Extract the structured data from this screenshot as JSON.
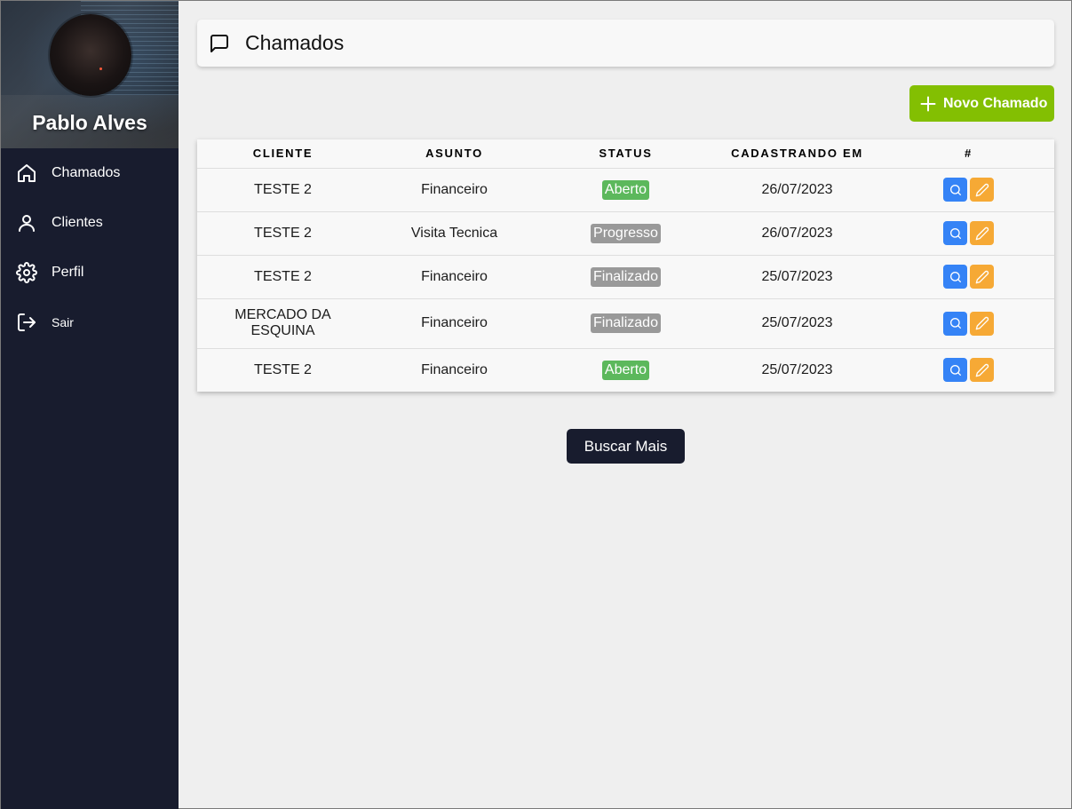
{
  "user": {
    "name": "Pablo Alves"
  },
  "nav": {
    "items": [
      {
        "label": "Chamados",
        "icon": "home-icon"
      },
      {
        "label": "Clientes",
        "icon": "user-icon"
      },
      {
        "label": "Perfil",
        "icon": "gear-icon"
      },
      {
        "label": "Sair",
        "icon": "logout-icon"
      }
    ]
  },
  "header": {
    "title": "Chamados",
    "icon": "message-square-icon"
  },
  "toolbar": {
    "new_label": "Novo Chamado",
    "new_icon": "plus-icon"
  },
  "table": {
    "columns": [
      "CLIENTE",
      "ASUNTO",
      "STATUS",
      "CADASTRANDO EM",
      "#"
    ],
    "rows": [
      {
        "cliente": "TESTE 2",
        "assunto": "Financeiro",
        "status": "Aberto",
        "data": "26/07/2023"
      },
      {
        "cliente": "TESTE 2",
        "assunto": "Visita Tecnica",
        "status": "Progresso",
        "data": "26/07/2023"
      },
      {
        "cliente": "TESTE 2",
        "assunto": "Financeiro",
        "status": "Finalizado",
        "data": "25/07/2023"
      },
      {
        "cliente": "MERCADO DA ESQUINA",
        "assunto": "Financeiro",
        "status": "Finalizado",
        "data": "25/07/2023"
      },
      {
        "cliente": "TESTE 2",
        "assunto": "Financeiro",
        "status": "Aberto",
        "data": "25/07/2023"
      }
    ]
  },
  "status_colors": {
    "Aberto": "#5cb85c",
    "Progresso": "#999999",
    "Finalizado": "#999999"
  },
  "footer": {
    "more_label": "Buscar Mais"
  },
  "colors": {
    "sidebar": "#181c2e",
    "accent_green": "#83bf02",
    "search_blue": "#3583f6",
    "edit_orange": "#f6a935"
  }
}
